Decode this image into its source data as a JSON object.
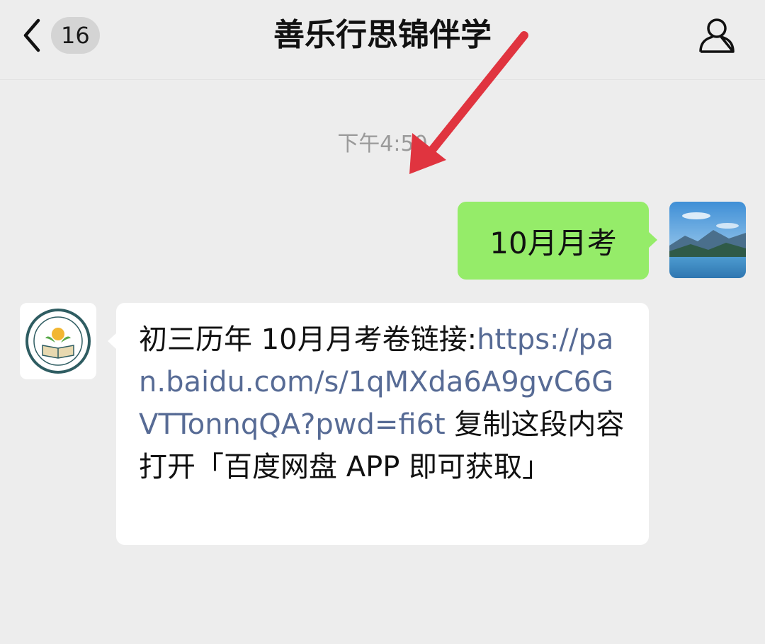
{
  "header": {
    "back_icon": "chevron-left-icon",
    "unread_count": "16",
    "title": "善乐行思锦伴学",
    "profile_icon": "person-icon"
  },
  "chat": {
    "timestamp": "下午4:50",
    "messages": [
      {
        "sender": "self",
        "text": "10月月考"
      },
      {
        "sender": "other",
        "text_before": "初三历年 10月月考卷链接:",
        "link": "https://pan.baidu.com/s/1qMXda6A9gvC6GVTTonnqQA?pwd=fi6t",
        "text_after": " 复制这段内容打开「百度网盘 APP 即可获取」"
      }
    ]
  },
  "colors": {
    "background": "#ededed",
    "self_bubble": "#95ec69",
    "other_bubble": "#ffffff",
    "link": "#576b95",
    "annotation_arrow": "#e0343f"
  }
}
